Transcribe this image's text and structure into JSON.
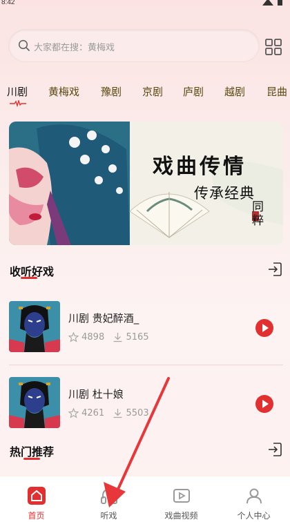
{
  "status_bar": {
    "time": "8:42"
  },
  "search": {
    "placeholder": "大家都在搜：黄梅戏"
  },
  "categories": [
    {
      "label": "川剧",
      "active": true
    },
    {
      "label": "黄梅戏"
    },
    {
      "label": "豫剧"
    },
    {
      "label": "京剧"
    },
    {
      "label": "庐剧"
    },
    {
      "label": "越剧"
    },
    {
      "label": "昆曲"
    }
  ],
  "banner": {
    "title": "戏曲传情",
    "subtitle": "传承经典",
    "stamp": "同粹"
  },
  "section_listen": {
    "title": "收听好戏",
    "items": [
      {
        "title": "川剧 贵妃醉酒_",
        "likes": "4898",
        "downloads": "5165"
      },
      {
        "title": "川剧 杜十娘",
        "likes": "4261",
        "downloads": "5503"
      }
    ]
  },
  "section_hot": {
    "title": "热门推荐"
  },
  "bottom_nav": [
    {
      "label": "首页",
      "icon": "home-icon",
      "active": true
    },
    {
      "label": "听戏",
      "icon": "headphones-icon"
    },
    {
      "label": "戏曲视频",
      "icon": "video-icon"
    },
    {
      "label": "个人中心",
      "icon": "person-icon"
    }
  ],
  "colors": {
    "accent": "#e23030",
    "tab_text": "#5a4a10"
  }
}
